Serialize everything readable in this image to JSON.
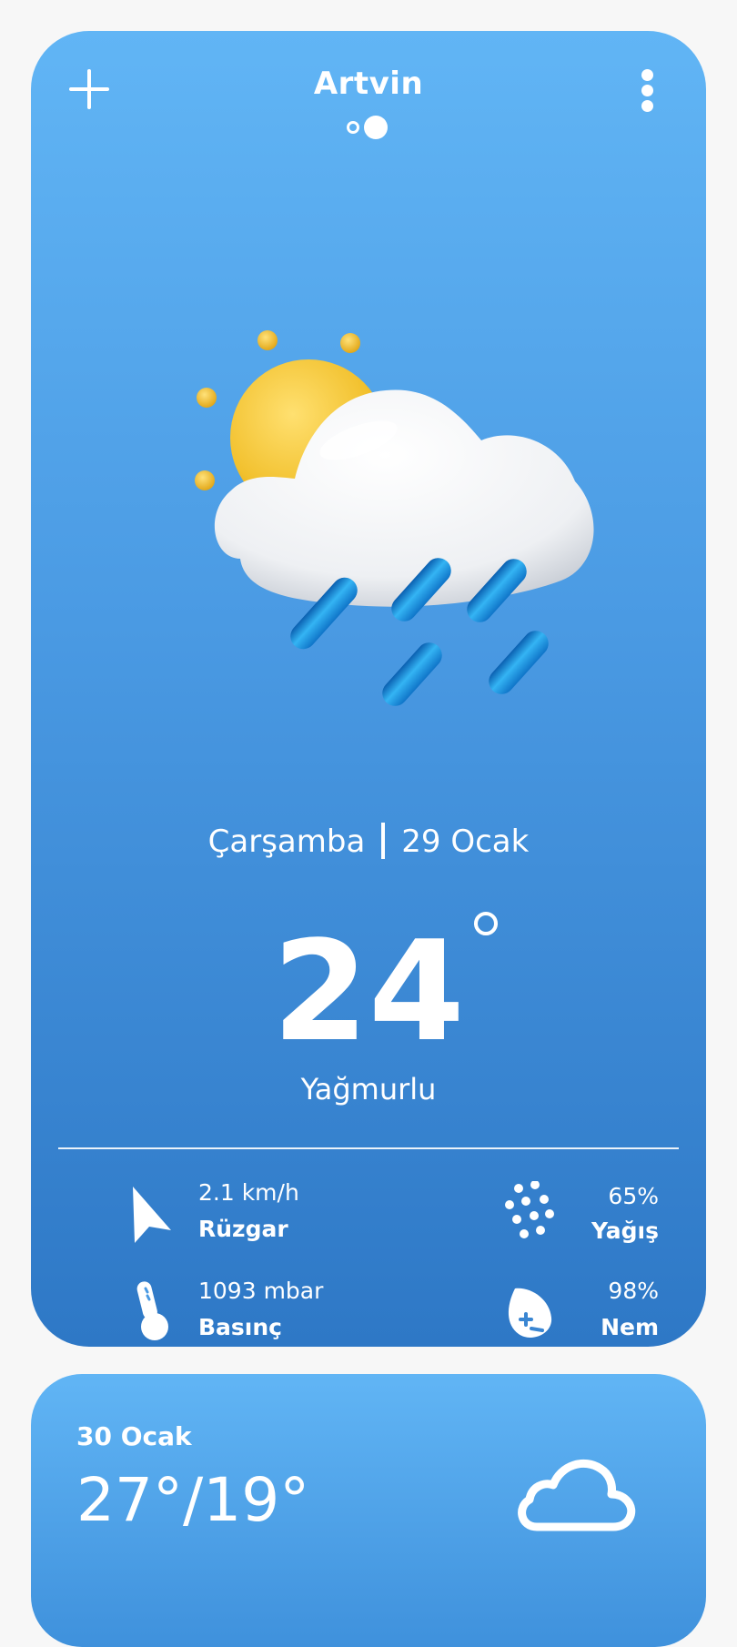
{
  "header": {
    "city": "Artvin",
    "page_count": 2,
    "active_page": 2,
    "add_icon": "plus-icon",
    "menu_icon": "vertical-dots-icon"
  },
  "current": {
    "day": "Çarşamba",
    "date": "29 Ocak",
    "temperature": "24",
    "condition": "Yağmurlu",
    "illustration_icon": "sun-cloud-rain-icon"
  },
  "stats": {
    "wind": {
      "value": "2.1 km/h",
      "label": "Rüzgar",
      "icon": "navigation-arrow-icon"
    },
    "precipitation": {
      "value": "65%",
      "label": "Yağış",
      "icon": "rain-drops-icon"
    },
    "pressure": {
      "value": "1093 mbar",
      "label": "Basınç",
      "icon": "thermometer-icon"
    },
    "humidity": {
      "value": "98%",
      "label": "Nem",
      "icon": "humidity-drop-icon"
    }
  },
  "forecast": {
    "date": "30 Ocak",
    "high": "27°",
    "low": "19°",
    "separator": "/",
    "icon": "cloud-icon"
  },
  "colors": {
    "card_top": "#61b5f5",
    "card_bottom": "#2e78c6",
    "text": "#ffffff",
    "background": "#f7f7f7",
    "sun": "#f2c12e",
    "rain": "#1b8fe0"
  }
}
